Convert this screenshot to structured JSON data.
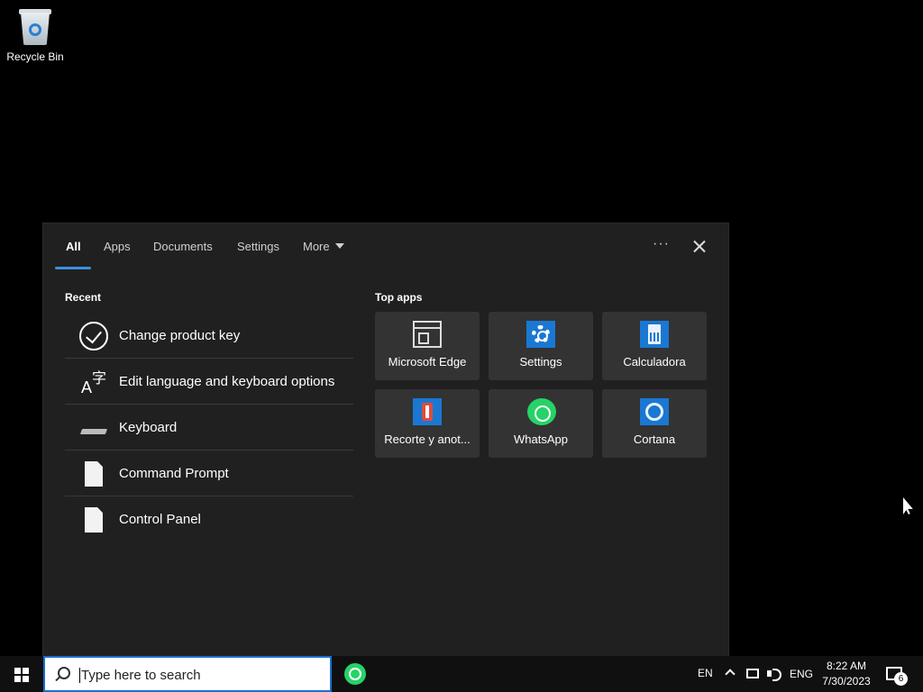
{
  "desktop": {
    "recycle_bin_label": "Recycle Bin"
  },
  "search_panel": {
    "tabs": [
      {
        "label": "All",
        "active": true
      },
      {
        "label": "Apps"
      },
      {
        "label": "Documents"
      },
      {
        "label": "Settings"
      },
      {
        "label": "More"
      }
    ],
    "options_icon": "more-options-icon",
    "close_icon": "close-icon",
    "recent": {
      "title": "Recent",
      "items": [
        {
          "label": "Change product key",
          "icon": "checkmark-circle-icon"
        },
        {
          "label": "Edit language and keyboard options",
          "icon": "language-icon"
        },
        {
          "label": "Keyboard",
          "icon": "keyboard-icon"
        },
        {
          "label": "Command Prompt",
          "icon": "document-icon"
        },
        {
          "label": "Control Panel",
          "icon": "document-icon"
        }
      ]
    },
    "top_apps": {
      "title": "Top apps",
      "apps": [
        {
          "label": "Microsoft Edge",
          "icon": "edge-icon"
        },
        {
          "label": "Settings",
          "icon": "settings-gear-icon"
        },
        {
          "label": "Calculadora",
          "icon": "calculator-icon"
        },
        {
          "label": "Recorte y anot...",
          "icon": "snipping-tool-icon"
        },
        {
          "label": "WhatsApp",
          "icon": "whatsapp-icon"
        },
        {
          "label": "Cortana",
          "icon": "cortana-icon"
        }
      ]
    }
  },
  "taskbar": {
    "search_placeholder": "Type here to search",
    "input_lang": "EN",
    "lang": "ENG",
    "time": "8:22 AM",
    "date": "7/30/2023",
    "notification_count": "6",
    "accent_color": "#1a6fd1"
  }
}
